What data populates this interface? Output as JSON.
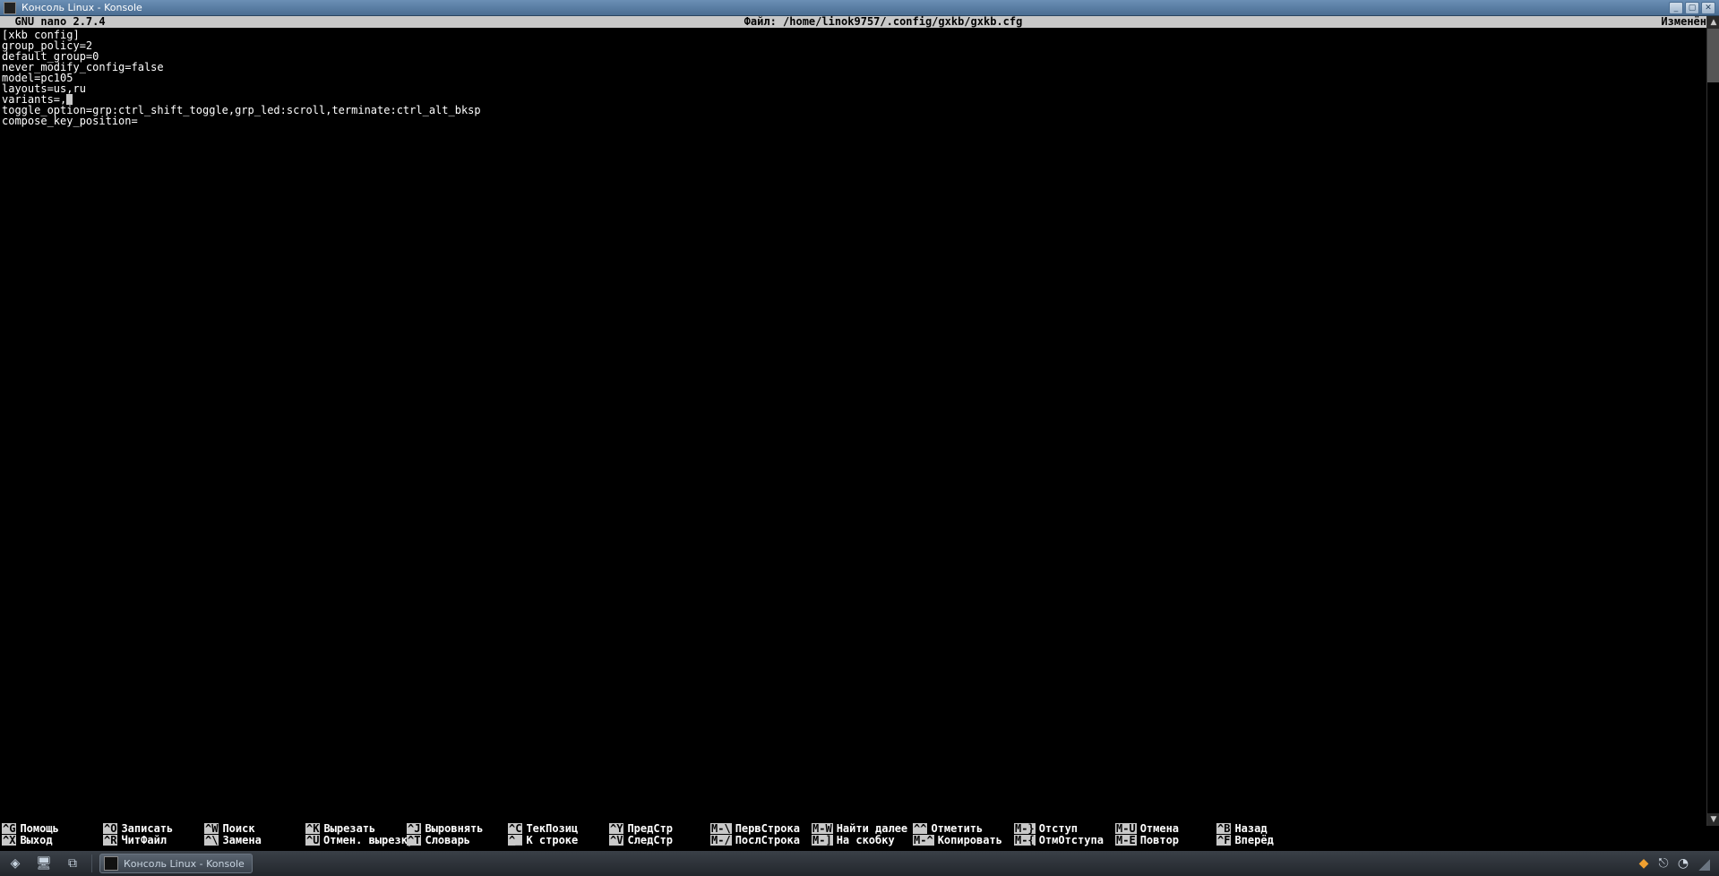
{
  "window": {
    "title": "Консоль Linux - Konsole"
  },
  "nano": {
    "version_label": "  GNU nano 2.7.4",
    "file_label": "Файл: /home/linok9757/.config/gxkb/gxkb.cfg",
    "modified_label": "Изменён"
  },
  "file_lines": [
    "[xkb config]",
    "group_policy=2",
    "default_group=0",
    "never_modify_config=false",
    "model=pc105",
    "layouts=us,ru",
    "variants=,",
    "toggle_option=grp:ctrl_shift_toggle,grp_led:scroll,terminate:ctrl_alt_bksp",
    "compose_key_position="
  ],
  "cursor_line": 6,
  "shortcuts_row1": [
    {
      "key": "^G",
      "label": "Помощь"
    },
    {
      "key": "^O",
      "label": "Записать"
    },
    {
      "key": "^W",
      "label": "Поиск"
    },
    {
      "key": "^K",
      "label": "Вырезать"
    },
    {
      "key": "^J",
      "label": "Выровнять"
    },
    {
      "key": "^C",
      "label": "ТекПозиц"
    },
    {
      "key": "^Y",
      "label": "ПредСтр"
    },
    {
      "key": "M-\\",
      "label": "ПервСтрока"
    },
    {
      "key": "M-W",
      "label": "Найти далее"
    },
    {
      "key": "^^",
      "label": "Отметить"
    },
    {
      "key": "M-}",
      "label": "Отступ"
    },
    {
      "key": "M-U",
      "label": "Отмена"
    },
    {
      "key": "^B",
      "label": "Назад"
    }
  ],
  "shortcuts_row2": [
    {
      "key": "^X",
      "label": "Выход"
    },
    {
      "key": "^R",
      "label": "ЧитФайл"
    },
    {
      "key": "^\\",
      "label": "Замена"
    },
    {
      "key": "^U",
      "label": "Отмен. вырезку"
    },
    {
      "key": "^T",
      "label": "Словарь"
    },
    {
      "key": "^_",
      "label": "К строке"
    },
    {
      "key": "^V",
      "label": "СледСтр"
    },
    {
      "key": "M-/",
      "label": "ПослСтрока"
    },
    {
      "key": "M-]",
      "label": "На скобку"
    },
    {
      "key": "M-^",
      "label": "Копировать"
    },
    {
      "key": "M-{",
      "label": "ОтмОтступа"
    },
    {
      "key": "M-E",
      "label": "Повтор"
    },
    {
      "key": "^F",
      "label": "Вперёд"
    }
  ],
  "taskbar": {
    "task_label": "Консоль Linux - Konsole"
  }
}
